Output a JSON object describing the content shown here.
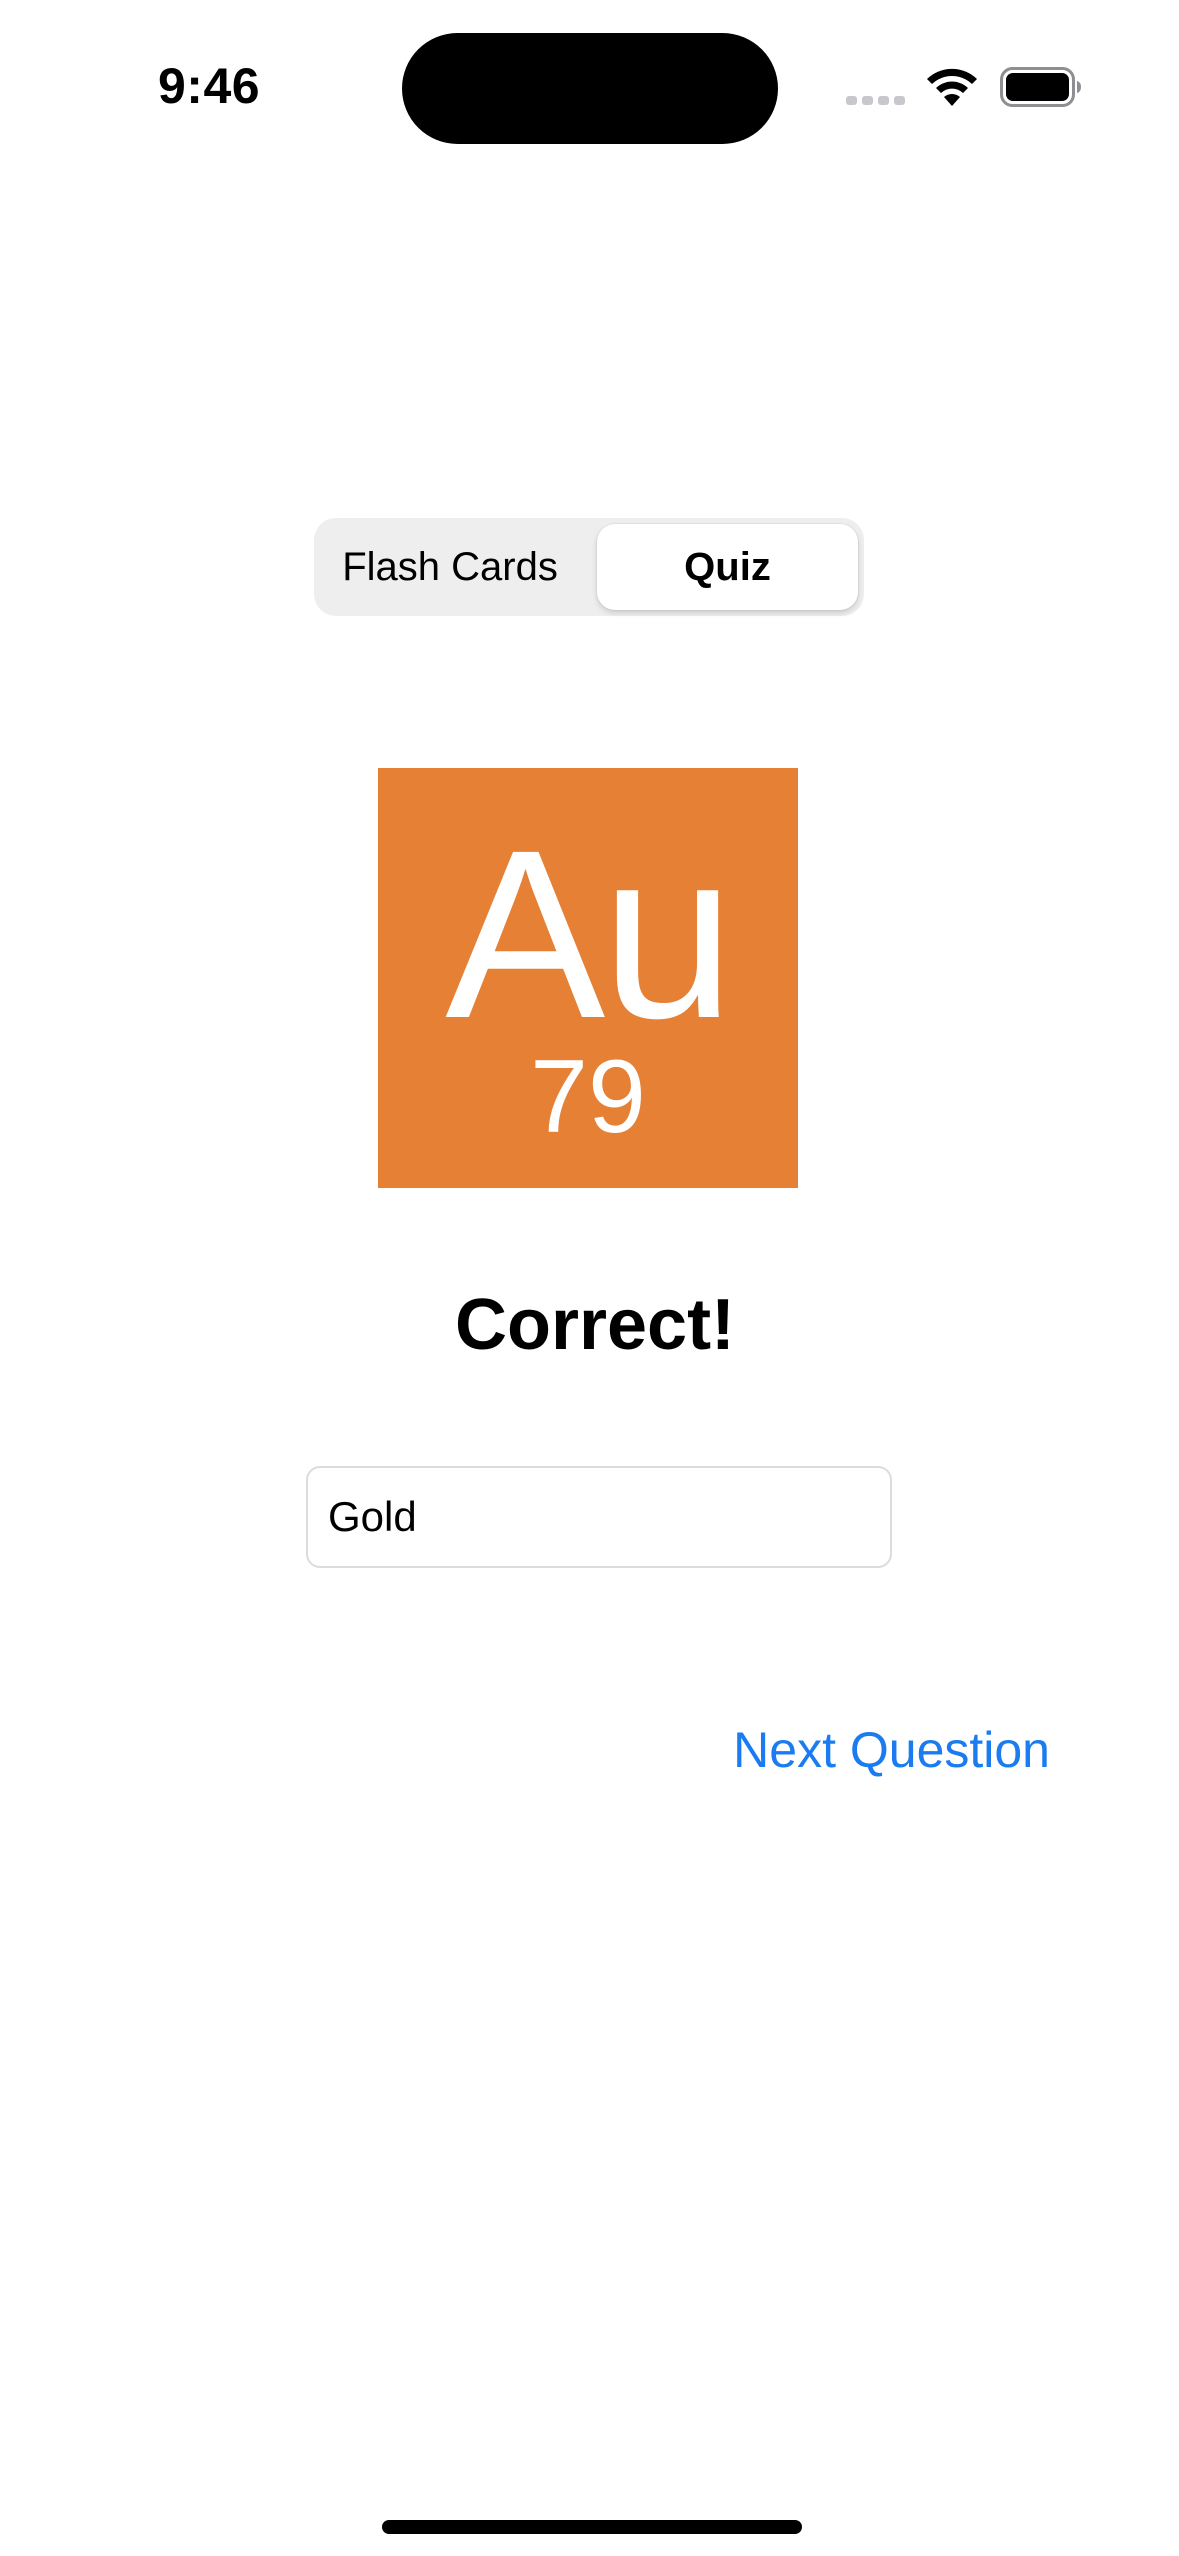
{
  "status_bar": {
    "time": "9:46"
  },
  "segmented_control": {
    "options": [
      {
        "label": "Flash Cards",
        "selected": false
      },
      {
        "label": "Quiz",
        "selected": true
      }
    ]
  },
  "element": {
    "symbol": "Au",
    "atomic_number": "79",
    "tile_color": "#e58035"
  },
  "quiz": {
    "result": "Correct!",
    "answer_value": "Gold",
    "next_label": "Next Question"
  },
  "colors": {
    "accent": "#1a7cf0"
  }
}
